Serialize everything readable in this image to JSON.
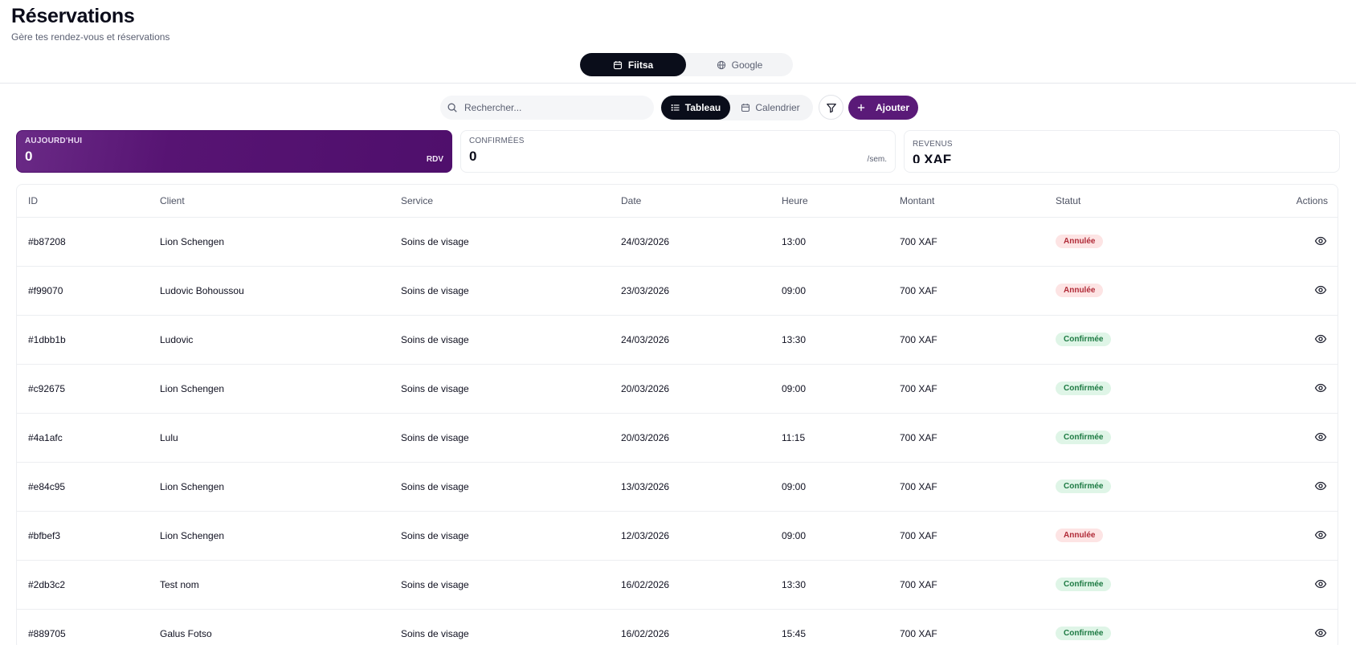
{
  "header": {
    "title": "Réservations",
    "subtitle": "Gère tes rendez-vous et réservations"
  },
  "source_switch": {
    "fiitsa_label": "Fiitsa",
    "google_label": "Google",
    "active": "Fiitsa"
  },
  "toolbar": {
    "search_placeholder": "Rechercher...",
    "view_table_label": "Tableau",
    "view_calendar_label": "Calendrier",
    "active_view": "Tableau",
    "add_label": "Ajouter"
  },
  "stats": {
    "today": {
      "label": "AUJOURD'HUI",
      "value": "0",
      "unit": "RDV"
    },
    "confirmed": {
      "label": "CONFIRMÉES",
      "value": "0",
      "unit": "/sem."
    },
    "revenue": {
      "label": "REVENUS",
      "value": "0 XAF"
    }
  },
  "table": {
    "headers": {
      "id": "ID",
      "client": "Client",
      "service": "Service",
      "date": "Date",
      "time": "Heure",
      "amount": "Montant",
      "status": "Statut",
      "actions": "Actions"
    },
    "rows": [
      {
        "id": "#b87208",
        "client": "Lion Schengen",
        "service": "Soins de visage",
        "date": "24/03/2026",
        "time": "13:00",
        "amount": "700 XAF",
        "status": "Annulée",
        "status_kind": "cancelled"
      },
      {
        "id": "#f99070",
        "client": "Ludovic Bohoussou",
        "service": "Soins de visage",
        "date": "23/03/2026",
        "time": "09:00",
        "amount": "700 XAF",
        "status": "Annulée",
        "status_kind": "cancelled"
      },
      {
        "id": "#1dbb1b",
        "client": "Ludovic",
        "service": "Soins de visage",
        "date": "24/03/2026",
        "time": "13:30",
        "amount": "700 XAF",
        "status": "Confirmée",
        "status_kind": "confirmed"
      },
      {
        "id": "#c92675",
        "client": "Lion Schengen",
        "service": "Soins de visage",
        "date": "20/03/2026",
        "time": "09:00",
        "amount": "700 XAF",
        "status": "Confirmée",
        "status_kind": "confirmed"
      },
      {
        "id": "#4a1afc",
        "client": "Lulu",
        "service": "Soins de visage",
        "date": "20/03/2026",
        "time": "11:15",
        "amount": "700 XAF",
        "status": "Confirmée",
        "status_kind": "confirmed"
      },
      {
        "id": "#e84c95",
        "client": "Lion Schengen",
        "service": "Soins de visage",
        "date": "13/03/2026",
        "time": "09:00",
        "amount": "700 XAF",
        "status": "Confirmée",
        "status_kind": "confirmed"
      },
      {
        "id": "#bfbef3",
        "client": "Lion Schengen",
        "service": "Soins de visage",
        "date": "12/03/2026",
        "time": "09:00",
        "amount": "700 XAF",
        "status": "Annulée",
        "status_kind": "cancelled"
      },
      {
        "id": "#2db3c2",
        "client": "Test nom",
        "service": "Soins de visage",
        "date": "16/02/2026",
        "time": "13:30",
        "amount": "700 XAF",
        "status": "Confirmée",
        "status_kind": "confirmed"
      },
      {
        "id": "#889705",
        "client": "Galus Fotso",
        "service": "Soins de visage",
        "date": "16/02/2026",
        "time": "15:45",
        "amount": "700 XAF",
        "status": "Confirmée",
        "status_kind": "confirmed"
      }
    ]
  },
  "icons": {
    "source_fiitsa": "calendar-icon",
    "source_google": "globe-icon",
    "search": "search-icon",
    "view_table": "list-icon",
    "view_calendar": "calendar-icon",
    "filter": "filter-icon",
    "add": "plus-icon",
    "row_action": "eye-icon"
  },
  "colors": {
    "brand": "#5a1a78",
    "dark": "#0a0d1a",
    "cancelled_bg": "#fde4e4",
    "cancelled_text": "#b02a37",
    "confirmed_bg": "#dff5e7",
    "confirmed_text": "#1d7a43"
  }
}
